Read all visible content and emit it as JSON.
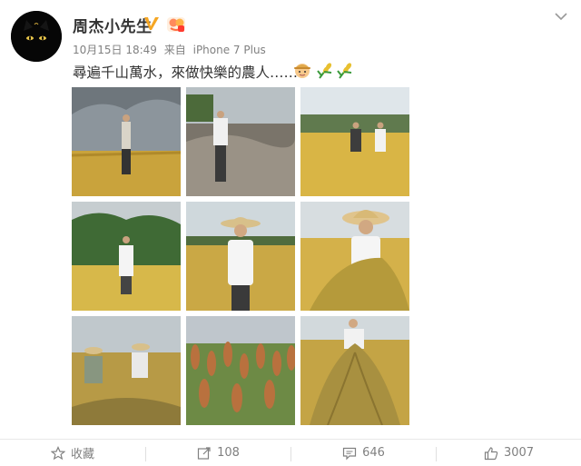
{
  "post": {
    "author": "周杰小先生",
    "time": "10月15日 18:49",
    "source_prefix": "来自",
    "source": "iPhone 7 Plus",
    "text": "尋遍千山萬水，來做快樂的農人……",
    "emojis": [
      "farmer-emoji",
      "wheat-emoji",
      "wheat-emoji"
    ]
  },
  "photos": [
    "photo-1",
    "photo-2",
    "photo-3",
    "photo-4",
    "photo-5",
    "photo-6",
    "photo-7",
    "photo-8",
    "photo-9"
  ],
  "actions": {
    "favorite_label": "收藏",
    "repost_count": "108",
    "comment_count": "646",
    "like_count": "3007"
  },
  "colors": {
    "accent_gold": "#f5a623",
    "field_gold": "#d9b545",
    "text_gray": "#808080"
  }
}
